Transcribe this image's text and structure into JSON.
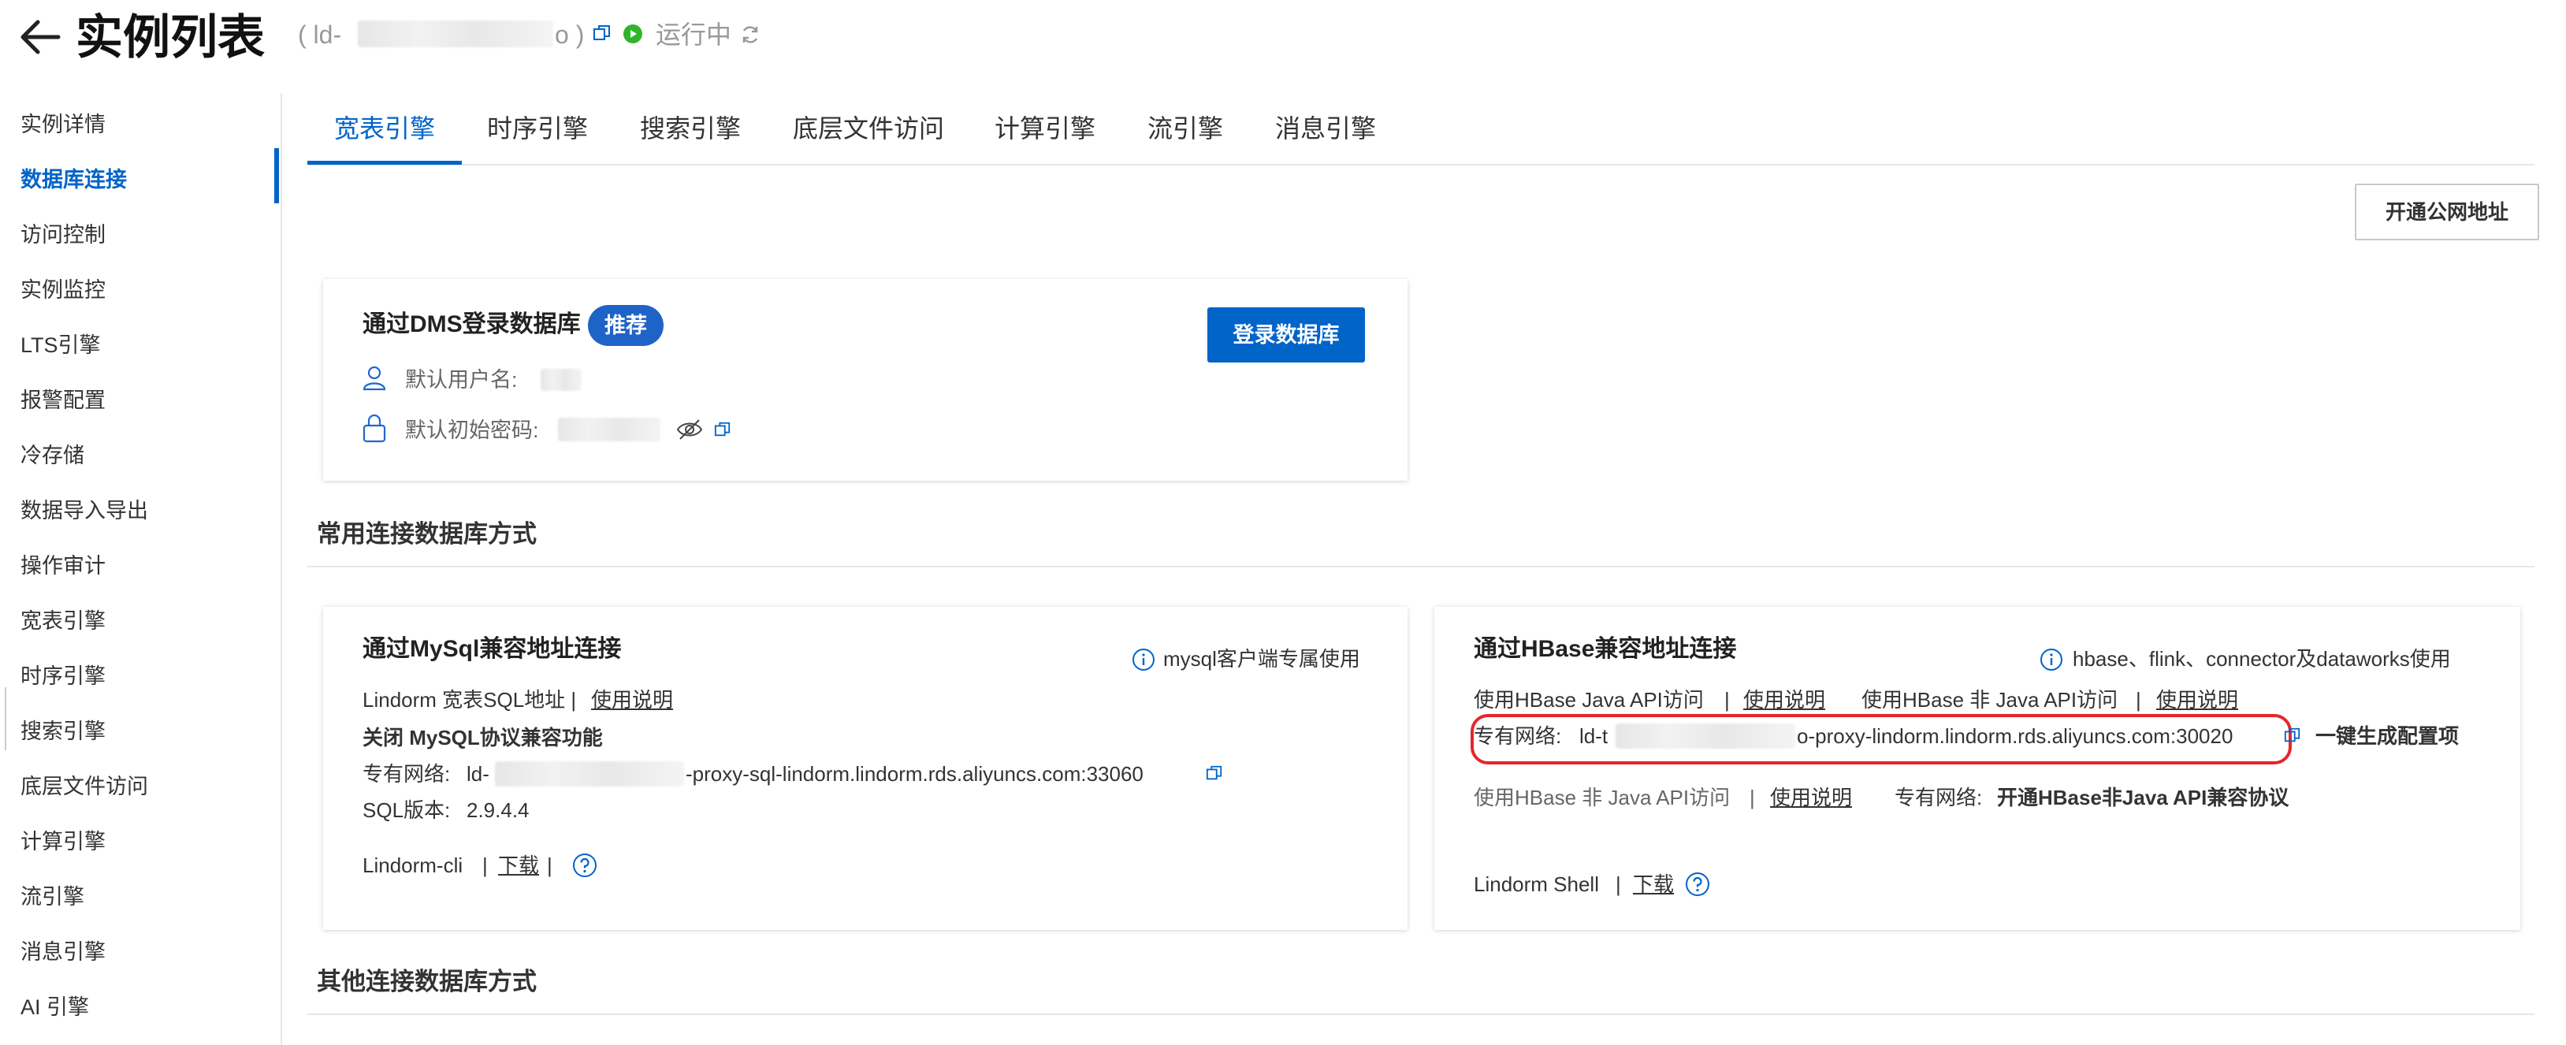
{
  "header": {
    "title": "实例列表",
    "instance_id_prefix": "( ld-",
    "instance_id_suffix": "o )",
    "status": "运行中"
  },
  "sidebar": {
    "items": [
      {
        "label": "实例详情"
      },
      {
        "label": "数据库连接"
      },
      {
        "label": "访问控制"
      },
      {
        "label": "实例监控"
      },
      {
        "label": "LTS引擎"
      },
      {
        "label": "报警配置"
      },
      {
        "label": "冷存储"
      },
      {
        "label": "数据导入导出"
      },
      {
        "label": "操作审计"
      },
      {
        "label": "宽表引擎"
      },
      {
        "label": "时序引擎"
      },
      {
        "label": "搜索引擎"
      },
      {
        "label": "底层文件访问"
      },
      {
        "label": "计算引擎"
      },
      {
        "label": "流引擎"
      },
      {
        "label": "消息引擎"
      },
      {
        "label": "AI 引擎"
      }
    ],
    "active": "数据库连接"
  },
  "tabs": [
    {
      "label": "宽表引擎"
    },
    {
      "label": "时序引擎"
    },
    {
      "label": "搜索引擎"
    },
    {
      "label": "底层文件访问"
    },
    {
      "label": "计算引擎"
    },
    {
      "label": "流引擎"
    },
    {
      "label": "消息引擎"
    }
  ],
  "toolbar": {
    "public_address_button": "开通公网地址"
  },
  "dms": {
    "title": "通过DMS登录数据库",
    "badge": "推荐",
    "login_button": "登录数据库",
    "username_label": "默认用户名:",
    "password_label": "默认初始密码:"
  },
  "common_section": {
    "title": "常用连接数据库方式"
  },
  "mysql": {
    "title": "通过MySql兼容地址连接",
    "hint": "mysql客户端专属使用",
    "sql_address_label": "Lindorm 宽表SQL地址 |",
    "usage_link": "使用说明",
    "close_link": "关闭 MySQL协议兼容功能",
    "vpc_label": "专有网络:",
    "vpc_prefix": "ld-",
    "vpc_suffix": "-proxy-sql-lindorm.lindorm.rds.aliyuncs.com:33060",
    "sql_version_label": "SQL版本:",
    "sql_version": "2.9.4.4",
    "cli_label": "Lindorm-cli",
    "sep1": "|",
    "download_link": "下载",
    "sep2": "|"
  },
  "hbase": {
    "title": "通过HBase兼容地址连接",
    "hint": "hbase、flink、connector及dataworks使用",
    "java_label": "使用HBase Java API访问",
    "sep1": "|",
    "usage_link_1": "使用说明",
    "non_java_label": "使用HBase 非 Java API访问",
    "sep2": "|",
    "usage_link_2": "使用说明",
    "vpc_label": "专有网络:",
    "vpc_prefix": "ld-t",
    "vpc_suffix": "o-proxy-lindorm.lindorm.rds.aliyuncs.com:30020",
    "generate_link": "一键生成配置项",
    "non_java_label_2": "使用HBase 非 Java API访问",
    "sep3": "|",
    "usage_link_3": "使用说明",
    "vpc_label_2": "专有网络:",
    "enable_link": "开通HBase非Java API兼容协议",
    "shell_label": "Lindorm Shell",
    "sep4": "|",
    "download_link": "下载"
  },
  "other_section": {
    "title": "其他连接数据库方式"
  },
  "colors": {
    "accent": "#0064c8",
    "status_green": "#2fb52a",
    "highlight_red": "#e4262b"
  }
}
